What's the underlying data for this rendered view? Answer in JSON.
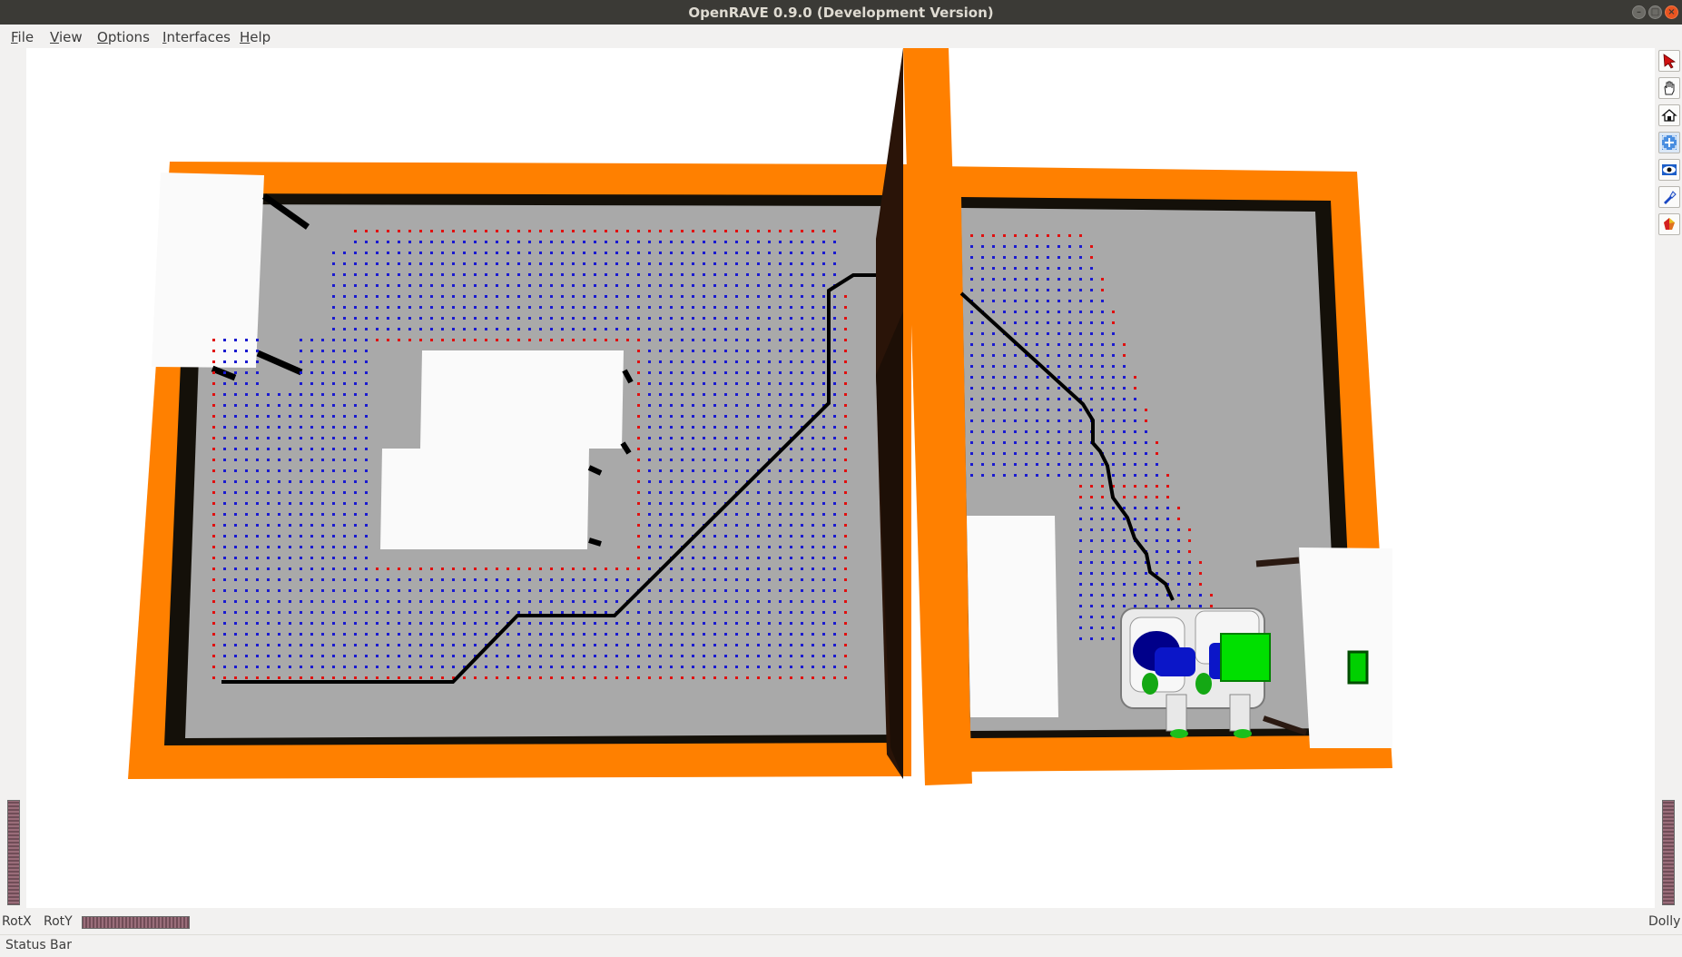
{
  "window": {
    "title": "OpenRAVE 0.9.0 (Development Version)",
    "controls": [
      {
        "name": "minimize",
        "glyph": "–"
      },
      {
        "name": "maximize",
        "glyph": "□"
      },
      {
        "name": "close",
        "glyph": "×"
      }
    ]
  },
  "menubar": {
    "items": [
      {
        "id": "file",
        "label": "File"
      },
      {
        "id": "view",
        "label": "View"
      },
      {
        "id": "options",
        "label": "Options"
      },
      {
        "id": "interfaces",
        "label": "Interfaces"
      },
      {
        "id": "help",
        "label": "Help"
      }
    ]
  },
  "toolbar": {
    "tools": [
      {
        "id": "select",
        "icon": "arrow-pointer-icon"
      },
      {
        "id": "pan",
        "icon": "hand-icon"
      },
      {
        "id": "home",
        "icon": "house-icon"
      },
      {
        "id": "view-all",
        "icon": "view-all-icon"
      },
      {
        "id": "seek",
        "icon": "eye-icon"
      },
      {
        "id": "perspective",
        "icon": "flashlight-icon"
      },
      {
        "id": "collision",
        "icon": "shapes-icon"
      }
    ]
  },
  "viewer": {
    "colors": {
      "wall": "#ff8000",
      "floor": "#a9a9a9",
      "grid_free": "#1a1ad0",
      "grid_border": "#e01010",
      "path": "#000000",
      "robot_accent": "#00d000"
    }
  },
  "wheels": {
    "rotx_label": "RotX",
    "roty_label": "RotY",
    "dolly_label": "Dolly"
  },
  "statusbar": {
    "text": "Status Bar"
  }
}
